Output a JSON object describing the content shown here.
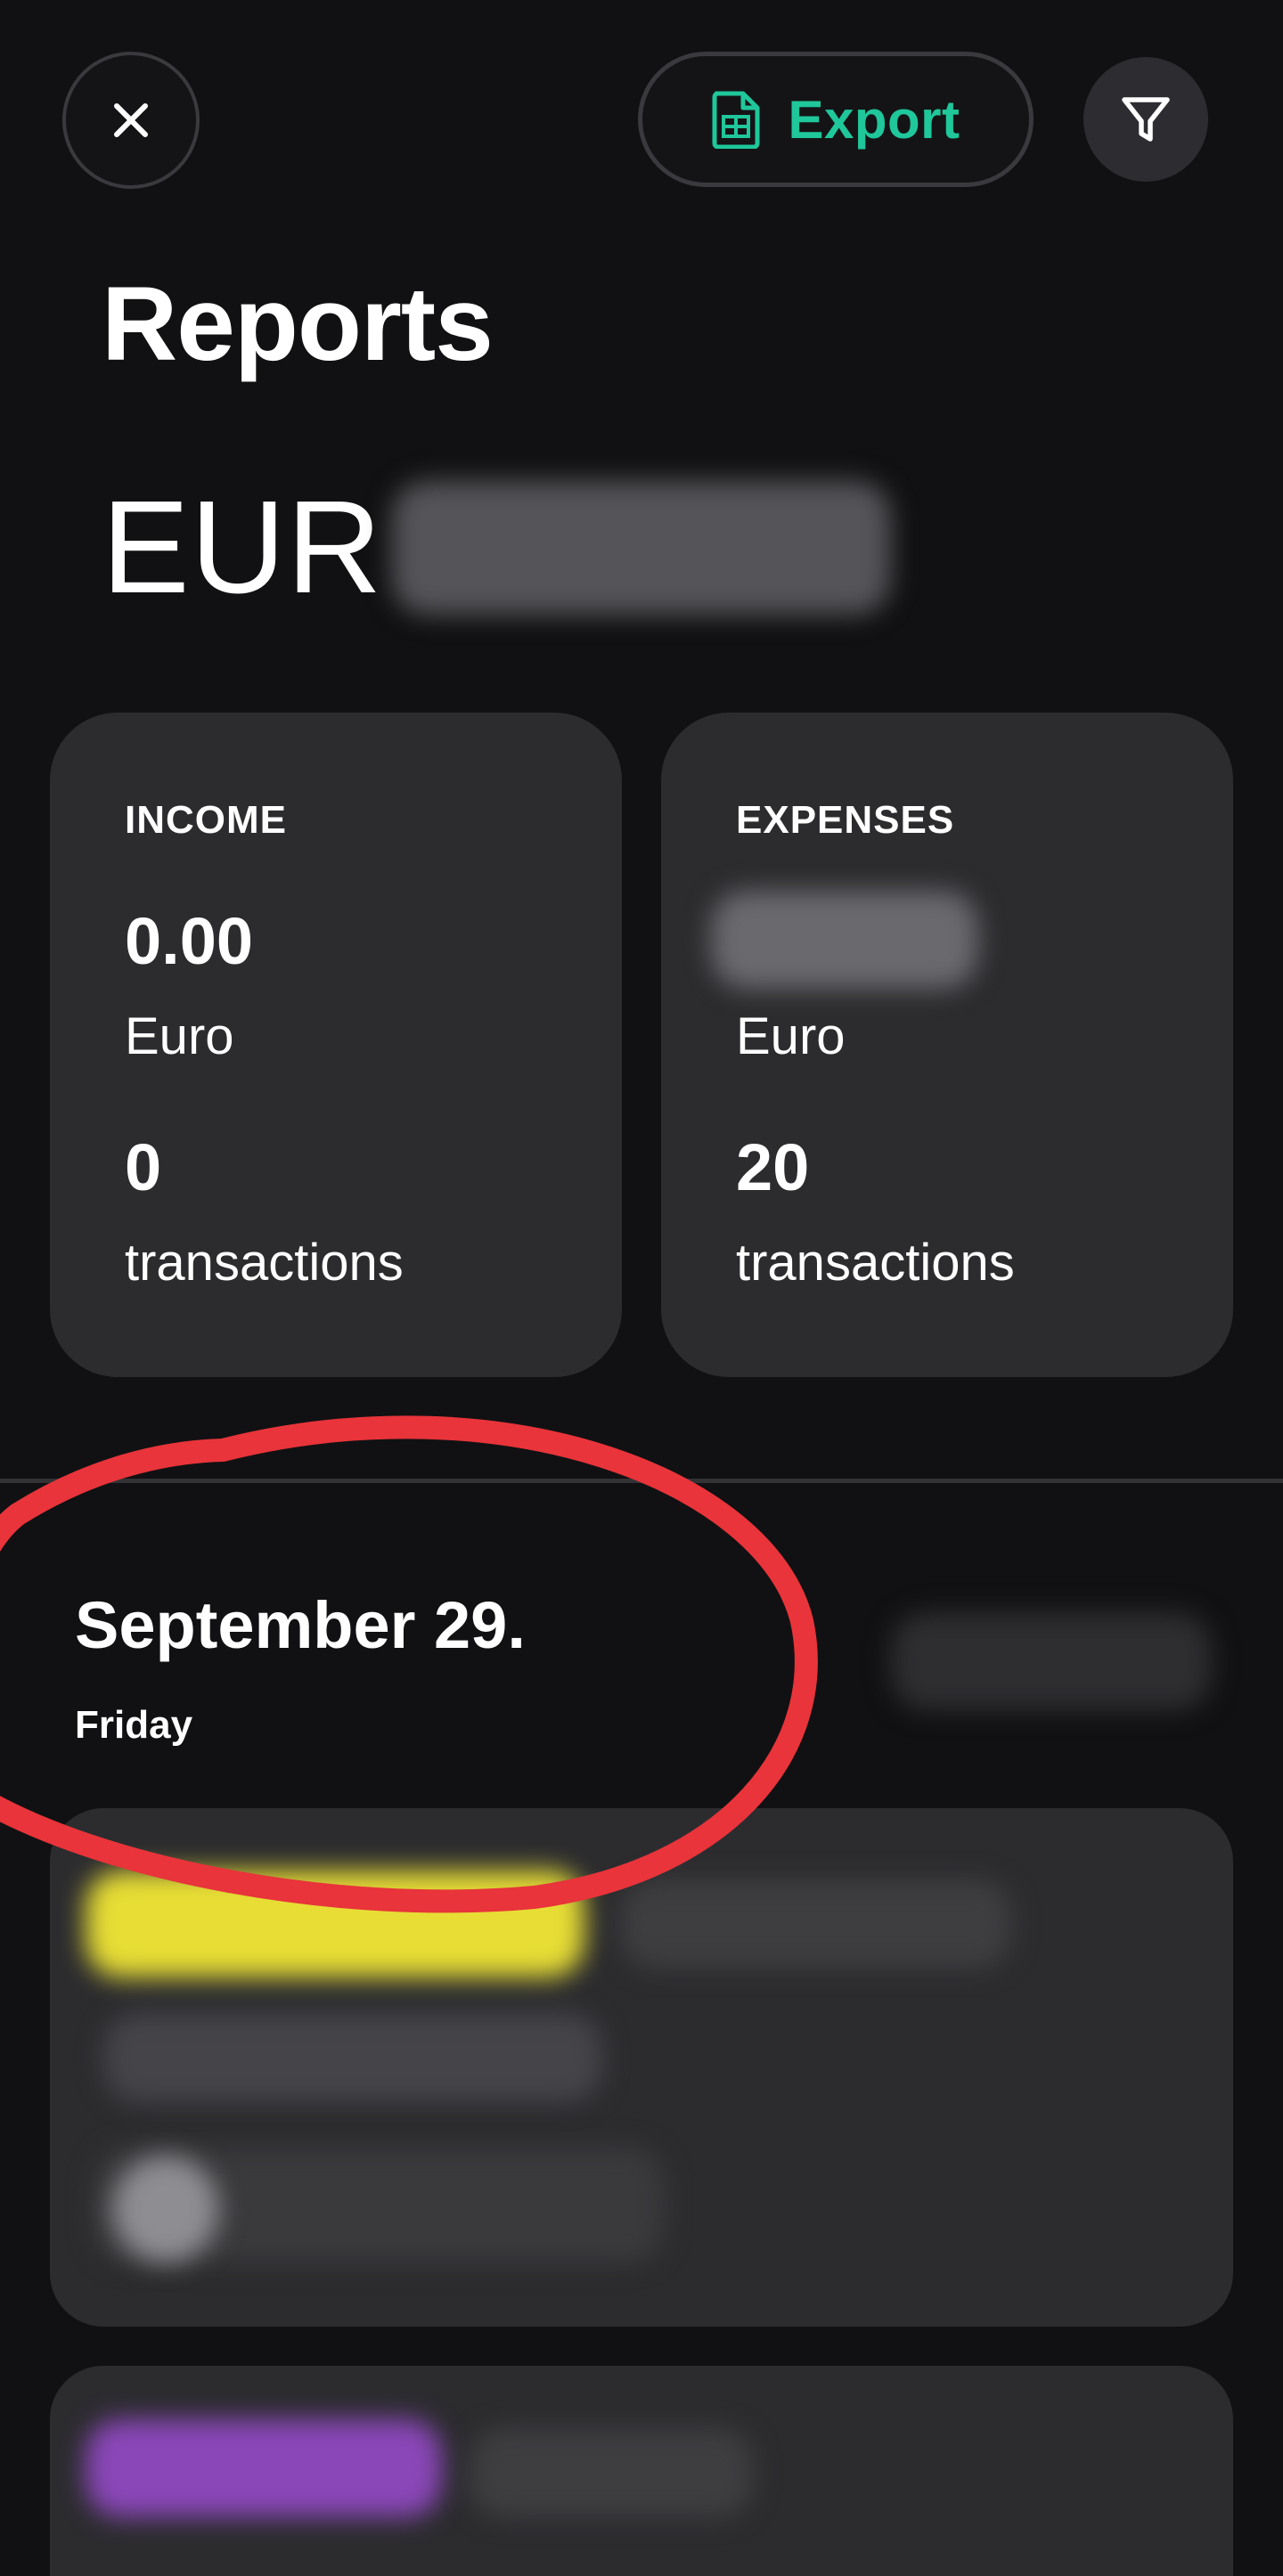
{
  "header": {
    "close_icon": "close-icon",
    "export_icon": "spreadsheet-icon",
    "export_label": "Export",
    "filter_icon": "filter-icon",
    "accent_color": "#1fc79a"
  },
  "page": {
    "title": "Reports",
    "currency_code": "EUR"
  },
  "summary": {
    "income": {
      "heading": "INCOME",
      "amount": "0.00",
      "currency": "Euro",
      "count": "0",
      "count_label": "transactions"
    },
    "expenses": {
      "heading": "EXPENSES",
      "currency": "Euro",
      "count": "20",
      "count_label": "transactions"
    }
  },
  "day_group": {
    "date": "September 29.",
    "weekday": "Friday"
  },
  "annotation": {
    "color": "#e8343a"
  }
}
